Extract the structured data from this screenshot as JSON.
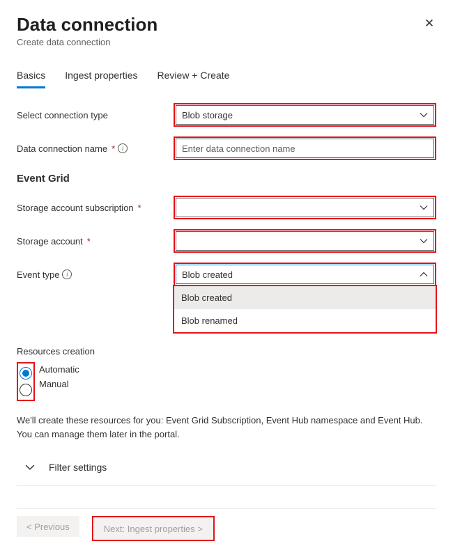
{
  "header": {
    "title": "Data connection",
    "subtitle": "Create data connection"
  },
  "tabs": [
    {
      "label": "Basics",
      "active": true
    },
    {
      "label": "Ingest properties",
      "active": false
    },
    {
      "label": "Review + Create",
      "active": false
    }
  ],
  "fields": {
    "connection_type": {
      "label": "Select connection type",
      "value": "Blob storage"
    },
    "connection_name": {
      "label": "Data connection name",
      "placeholder": "Enter data connection name",
      "required": true
    },
    "event_grid_title": "Event Grid",
    "storage_subscription": {
      "label": "Storage account subscription",
      "required": true,
      "value": ""
    },
    "storage_account": {
      "label": "Storage account",
      "required": true,
      "value": ""
    },
    "event_type": {
      "label": "Event type",
      "value": "Blob created",
      "options": [
        "Blob created",
        "Blob renamed"
      ]
    },
    "resources_creation": {
      "label": "Resources creation",
      "options": [
        "Automatic",
        "Manual"
      ],
      "selected": "Automatic"
    }
  },
  "help_text": "We'll create these resources for you: Event Grid Subscription, Event Hub namespace and Event Hub. You can manage them later in the portal.",
  "collapsible": {
    "filter_settings": "Filter settings"
  },
  "footer": {
    "previous": "< Previous",
    "next": "Next: Ingest properties >"
  }
}
